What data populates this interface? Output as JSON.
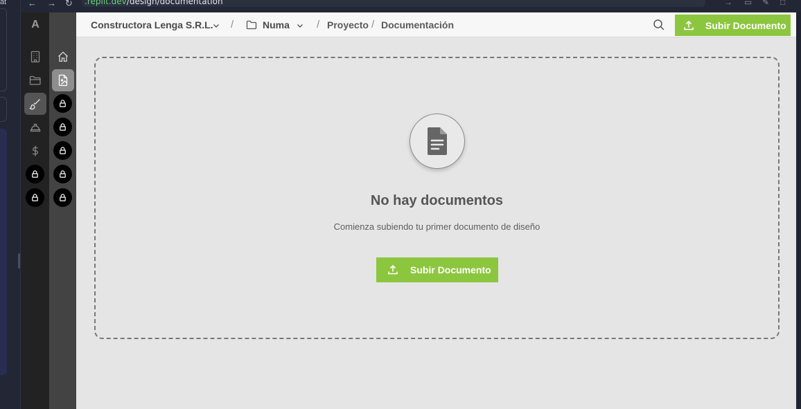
{
  "browser": {
    "left_panel_text": "at",
    "url_domain": ".replit.dev",
    "url_path": "/design/documentation"
  },
  "app": {
    "logo": "A",
    "rail_primary": [
      {
        "icon": "building-icon",
        "locked": false
      },
      {
        "icon": "folder-icon",
        "locked": false
      },
      {
        "icon": "brush-icon",
        "locked": false,
        "active": true
      },
      {
        "icon": "helmet-icon",
        "locked": false
      },
      {
        "icon": "dollar-icon",
        "locked": false
      },
      {
        "icon": "lock-icon",
        "locked": true
      },
      {
        "icon": "lock-icon",
        "locked": true
      }
    ],
    "rail_secondary": [
      {
        "icon": "home-icon",
        "locked": false
      },
      {
        "icon": "document-image-icon",
        "locked": false,
        "active": true
      },
      {
        "icon": "lock-icon",
        "locked": true
      },
      {
        "icon": "lock-icon",
        "locked": true
      },
      {
        "icon": "lock-icon",
        "locked": true
      },
      {
        "icon": "lock-icon",
        "locked": true
      },
      {
        "icon": "lock-icon",
        "locked": true
      }
    ]
  },
  "header": {
    "company": "Constructora Lenga S.R.L.",
    "separator": "/",
    "folder": "Numa",
    "project": "Proyecto",
    "section": "Documentación",
    "upload_label": "Subir Documento"
  },
  "empty_state": {
    "title": "No hay documentos",
    "subtitle": "Comienza subiendo tu primer documento de diseño",
    "upload_label": "Subir Documento"
  },
  "colors": {
    "accent": "#8cc63f",
    "rail_dark": "#222222",
    "rail_mid": "#434343",
    "background": "#e5e5e5"
  }
}
